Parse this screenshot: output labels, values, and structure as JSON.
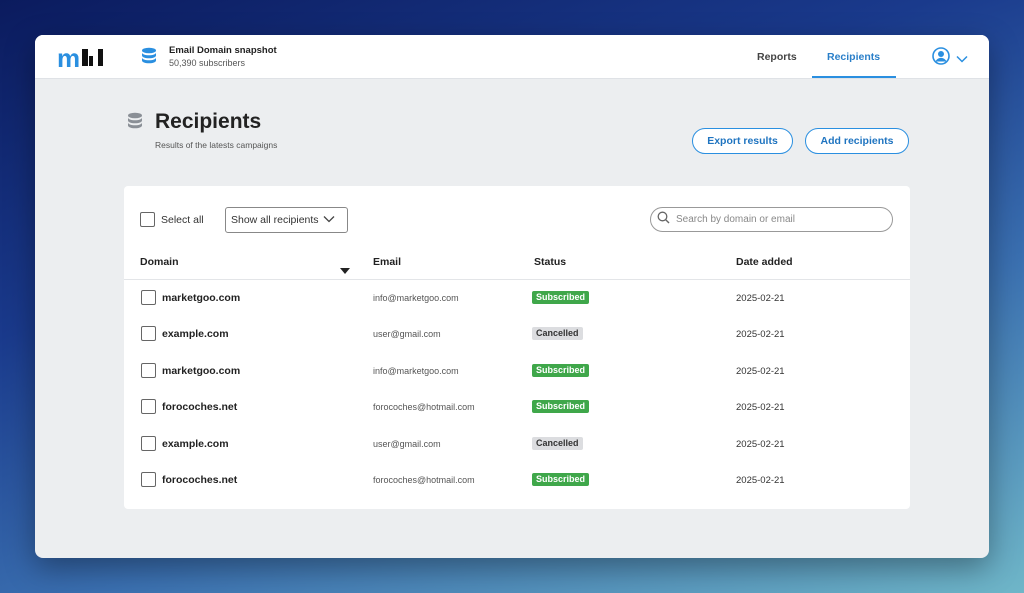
{
  "header": {
    "logo_text": "mDI",
    "snapshot_title": "Email Domain snapshot",
    "snapshot_subtitle": "50,390 subscribers",
    "nav": {
      "reports": "Reports",
      "recipients": "Recipients"
    },
    "accent_color": "#2a8fe0"
  },
  "page": {
    "title": "Recipients",
    "subtitle": "Results of the latests campaigns",
    "export_button": "Export results",
    "add_button": "Add recipients"
  },
  "toolbar": {
    "select_all_label": "Select all",
    "filter_value": "Show all recipients",
    "search_placeholder": "Search by domain or email"
  },
  "table": {
    "columns": {
      "domain": "Domain",
      "email": "Email",
      "status": "Status",
      "date": "Date added"
    },
    "rows": [
      {
        "domain": "marketgoo.com",
        "email": "info@marketgoo.com",
        "status": "Subscribed",
        "date": "2025-02-21"
      },
      {
        "domain": "example.com",
        "email": "user@gmail.com",
        "status": "Cancelled",
        "date": "2025-02-21"
      },
      {
        "domain": "marketgoo.com",
        "email": "info@marketgoo.com",
        "status": "Subscribed",
        "date": "2025-02-21"
      },
      {
        "domain": "forocoches.net",
        "email": "forocoches@hotmail.com",
        "status": "Subscribed",
        "date": "2025-02-21"
      },
      {
        "domain": "example.com",
        "email": "user@gmail.com",
        "status": "Cancelled",
        "date": "2025-02-21"
      },
      {
        "domain": "forocoches.net",
        "email": "forocoches@hotmail.com",
        "status": "Subscribed",
        "date": "2025-02-21"
      }
    ]
  },
  "status_colors": {
    "Subscribed": "#3fa74a",
    "Cancelled": "#dcdde0"
  }
}
